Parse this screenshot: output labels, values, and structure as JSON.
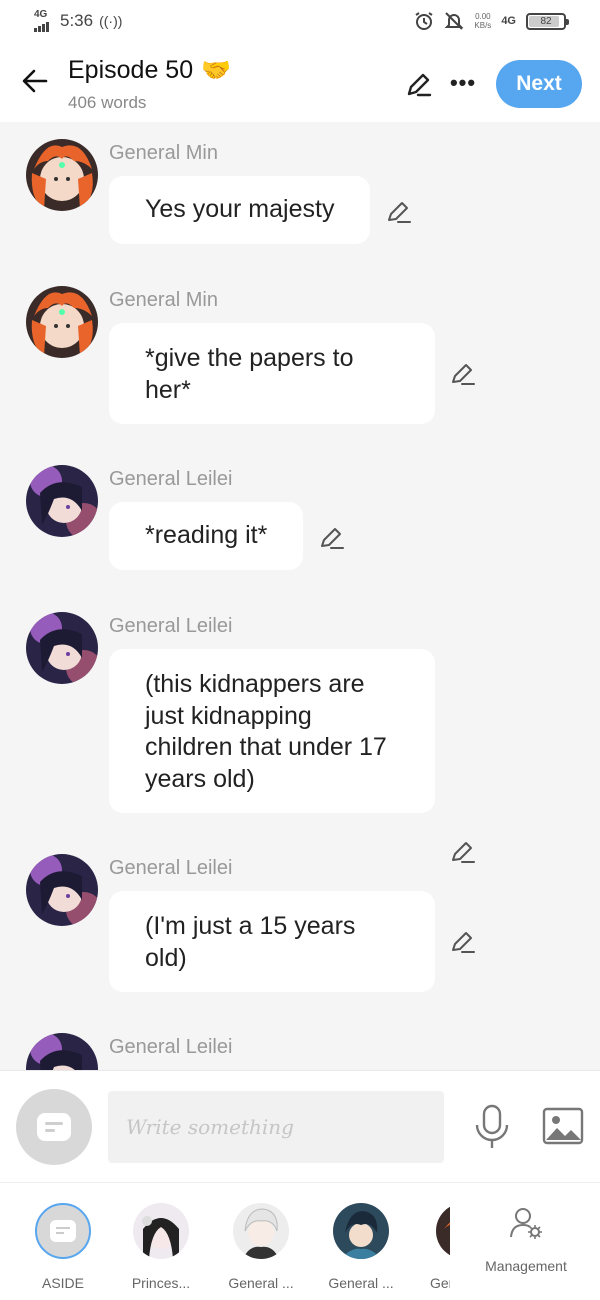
{
  "status_bar": {
    "network_label": "4G",
    "time": "5:36",
    "speed_value": "0.00",
    "speed_unit": "KB/s",
    "network_type": "4G",
    "battery_level": "82"
  },
  "header": {
    "title": "Episode 50",
    "title_emoji": "🤝",
    "word_count": "406 words",
    "next_label": "Next"
  },
  "messages": [
    {
      "speaker": "General Min",
      "text": "Yes your majesty"
    },
    {
      "speaker": "General Min",
      "text": "*give the papers to her*"
    },
    {
      "speaker": "General Leilei",
      "text": "*reading it*"
    },
    {
      "speaker": "General Leilei",
      "text": "(this kidnappers are just kidnapping children that under 17 years old)"
    },
    {
      "speaker": "General Leilei",
      "text": "(I'm just a 15 years old)"
    },
    {
      "speaker": "General Leilei",
      "text": ""
    }
  ],
  "composer": {
    "placeholder": "Write something"
  },
  "characters": [
    {
      "label": "ASIDE"
    },
    {
      "label": "Princes..."
    },
    {
      "label": "General ..."
    },
    {
      "label": "General ..."
    },
    {
      "label": "Ger"
    }
  ],
  "management_label": "Management",
  "colors": {
    "accent": "#57a6f0",
    "background": "#f5f5f5",
    "bubble": "#ffffff"
  }
}
